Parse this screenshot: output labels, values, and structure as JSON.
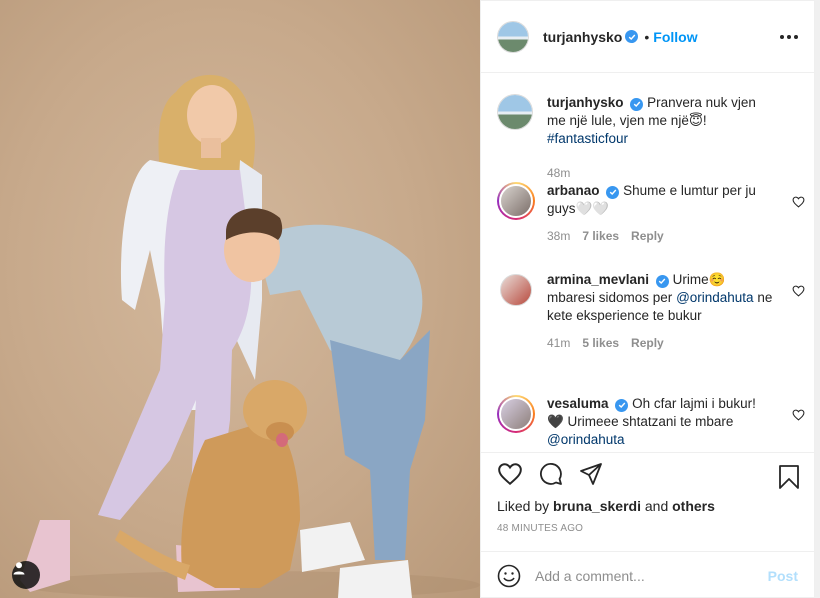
{
  "post": {
    "author": "turjanhysko",
    "follow_label": "Follow",
    "separator": "•",
    "more_icon": "more-options-icon"
  },
  "caption": {
    "username": "turjanhysko",
    "text": "Pranvera nuk vjen me një lule, vjen me një",
    "emoji": "😇",
    "after_emoji": "! ",
    "hashtag": "#fantasticfour",
    "time": "48m"
  },
  "comments": [
    {
      "username": "arbanao",
      "text": "Shume e lumtur per ju guys🤍🤍",
      "time": "38m",
      "likes": "7 likes",
      "reply": "Reply"
    },
    {
      "username": "armina_mevlani",
      "text": "Urime☺️ mbaresi sidomos per",
      "mention": "@orindahuta",
      "text_after": " ne kete eksperience te bukur",
      "time": "41m",
      "likes": "5 likes",
      "reply": "Reply"
    },
    {
      "username": "vesaluma",
      "text": "Oh cfar lajmi i bukur! 🖤 Urimeee shtatzani te mbare",
      "mention": "@orindahuta"
    }
  ],
  "likes_line": {
    "prefix": "Liked by",
    "user": "bruna_skerdi",
    "conj": "and",
    "others": "others"
  },
  "timestamp": "48 MINUTES AGO",
  "comment_box": {
    "placeholder": "Add a comment...",
    "post_label": "Post"
  },
  "colors": {
    "accent": "#0095f6",
    "verified": "#3897f0",
    "muted": "#8e8e8e",
    "post_disabled": "#b2dffc",
    "photo_backdrop": "#c7a98b"
  }
}
